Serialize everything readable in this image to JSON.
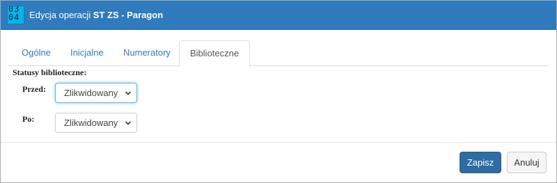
{
  "window": {
    "title_prefix": "Edycja operacji ",
    "title_strong": "ST ZS - Paragon",
    "icon": "app-logo-digits-icon",
    "icon_text": "03\n04"
  },
  "tabs": [
    {
      "label": "Ogólne",
      "active": false
    },
    {
      "label": "Inicjalne",
      "active": false
    },
    {
      "label": "Numeratory",
      "active": false
    },
    {
      "label": "Biblioteczne",
      "active": true
    }
  ],
  "section": {
    "label": "Statusy biblioteczne:"
  },
  "fields": {
    "przed": {
      "label": "Przed:",
      "value": "Zlikwidowany"
    },
    "po": {
      "label": "Po:",
      "value": "Zlikwidowany"
    }
  },
  "buttons": {
    "save": "Zapisz",
    "cancel": "Anuluj"
  },
  "colors": {
    "titlebar": "#2f7bbd",
    "primary": "#2d6da3",
    "link": "#337ab7"
  }
}
